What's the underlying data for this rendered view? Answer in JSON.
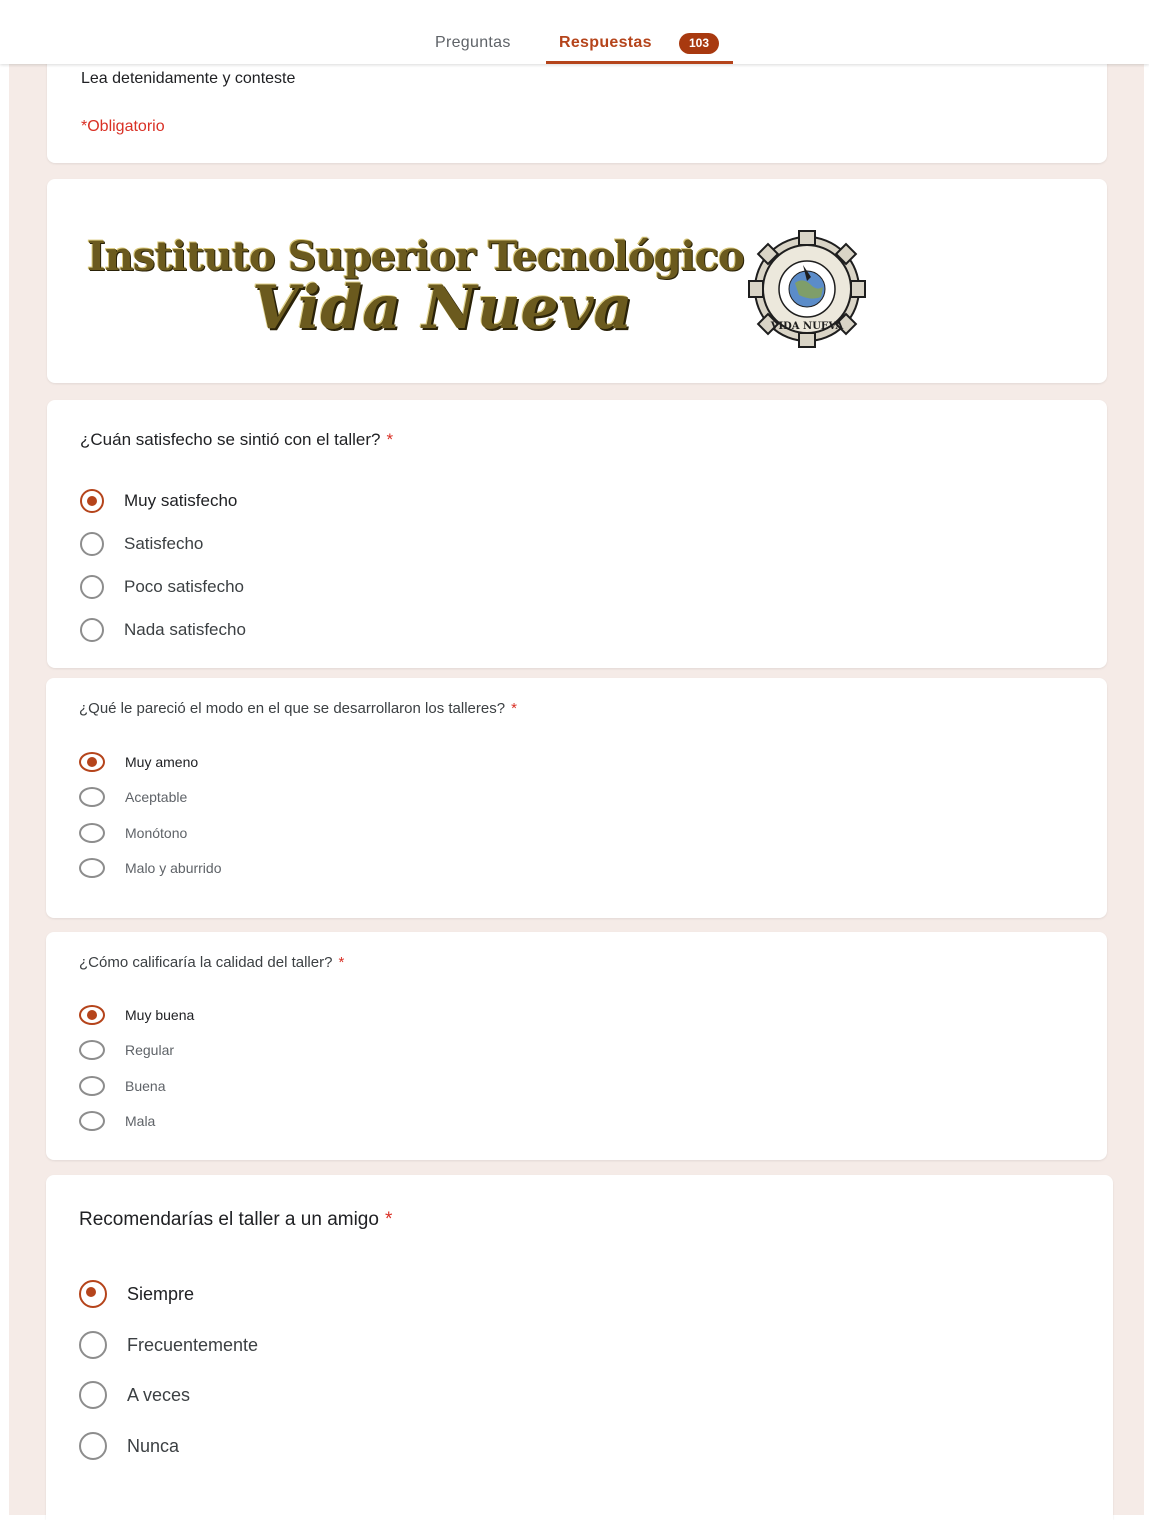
{
  "tabs": {
    "preguntas": "Preguntas",
    "respuestas": "Respuestas",
    "respuestas_count": "103"
  },
  "intro": {
    "description": "Lea detenidamente y conteste",
    "required_note": "*Obligatorio"
  },
  "logo": {
    "line1": "Instituto Superior Tecnológico",
    "line2": "Vida Nueva",
    "seal_text": "VIDA NUEVA"
  },
  "questions": [
    {
      "title": "¿Cuán satisfecho se sintió con el taller?",
      "required_mark": "*",
      "options": [
        "Muy satisfecho",
        "Satisfecho",
        "Poco satisfecho",
        "Nada satisfecho"
      ],
      "selected": 0
    },
    {
      "title": "¿Qué le pareció el modo en el que se desarrollaron los talleres?",
      "required_mark": "*",
      "options": [
        "Muy ameno",
        "Aceptable",
        "Monótono",
        "Malo y aburrido"
      ],
      "selected": 0
    },
    {
      "title": "¿Cómo calificaría la calidad del taller?",
      "required_mark": "*",
      "options": [
        "Muy buena",
        "Regular",
        "Buena",
        "Mala"
      ],
      "selected": 0
    },
    {
      "title": "Recomendarías el taller a un amigo",
      "required_mark": "*",
      "options": [
        "Siempre",
        "Frecuentemente",
        "A veces",
        "Nunca"
      ],
      "selected": 0
    }
  ],
  "colors": {
    "accent": "#b5441b",
    "page_bg": "#f5ebe7",
    "required": "#d93025"
  }
}
